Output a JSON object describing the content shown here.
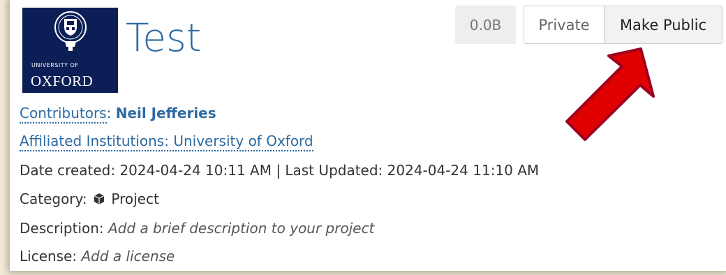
{
  "logo": {
    "line1": "UNIVERSITY OF",
    "line2": "OXFORD"
  },
  "project": {
    "title": "Test"
  },
  "storage": {
    "size": "0.0B"
  },
  "visibility": {
    "private_label": "Private",
    "make_public_label": "Make Public"
  },
  "meta": {
    "contributors_label": "Contributors",
    "contributor_name": "Neil Jefferies",
    "affiliated_label": "Affiliated Institutions: University of Oxford",
    "dates": "Date created: 2024-04-24 10:11 AM | Last Updated: 2024-04-24 11:10 AM",
    "category_label": "Category:",
    "category_value": "Project",
    "description_label": "Description:",
    "description_placeholder": "Add a brief description to your project",
    "license_label": "License:",
    "license_placeholder": "Add a license"
  },
  "colors": {
    "accent": "#2d6aa3",
    "arrow": "#e00000",
    "logo_bg": "#0b1f56"
  },
  "icons": {
    "category": "cube-icon",
    "annotation": "red-arrow-icon"
  }
}
